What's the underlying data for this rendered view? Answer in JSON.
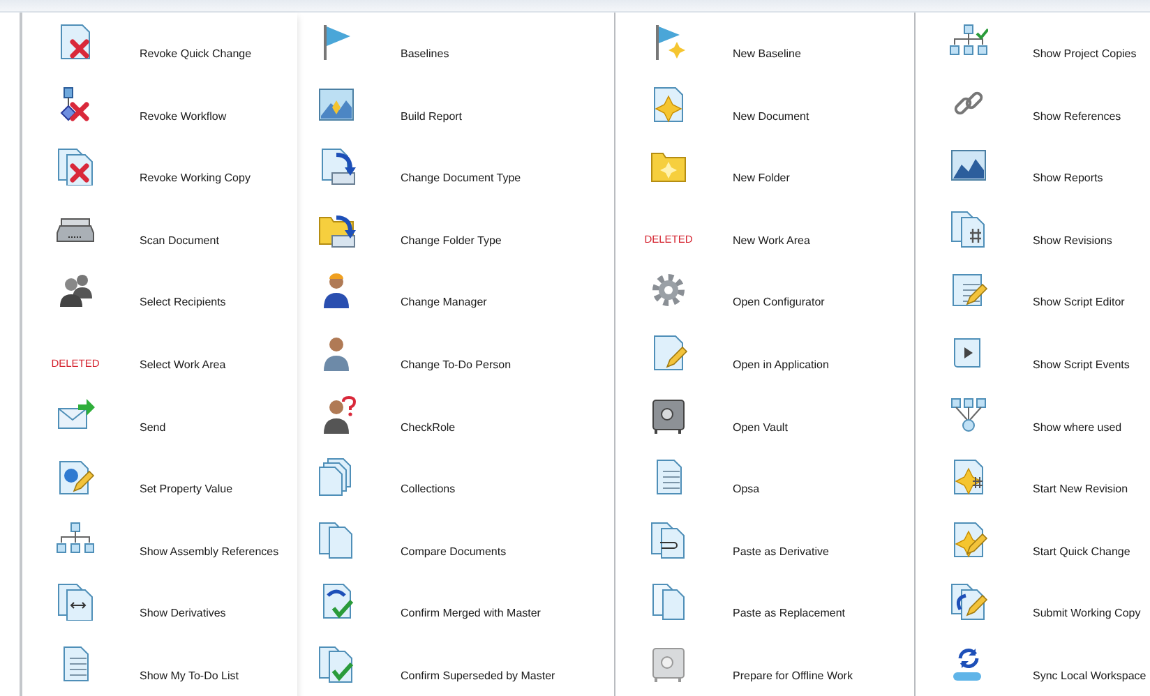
{
  "columns": [
    {
      "items": [
        {
          "label": "Revoke Quick Change"
        },
        {
          "label": "Revoke Workflow"
        },
        {
          "label": "Revoke Working Copy"
        },
        {
          "label": "Scan Document"
        },
        {
          "label": "Select Recipients"
        },
        {
          "label": "Select Work Area",
          "tag": "DELETED"
        },
        {
          "label": "Send"
        },
        {
          "label": "Set Property Value"
        },
        {
          "label": "Show Assembly References"
        },
        {
          "label": "Show Derivatives"
        },
        {
          "label": "Show My To-Do List"
        }
      ]
    },
    {
      "items": [
        {
          "label": "Baselines"
        },
        {
          "label": "Build Report"
        },
        {
          "label": "Change Document Type"
        },
        {
          "label": "Change Folder Type"
        },
        {
          "label": "Change Manager"
        },
        {
          "label": "Change To-Do Person"
        },
        {
          "label": "CheckRole"
        },
        {
          "label": "Collections"
        },
        {
          "label": "Compare Documents"
        },
        {
          "label": "Confirm Merged with Master"
        },
        {
          "label": "Confirm Superseded by Master"
        }
      ]
    },
    {
      "items": [
        {
          "label": "New Baseline"
        },
        {
          "label": "New Document"
        },
        {
          "label": "New Folder"
        },
        {
          "label": "New Work Area",
          "tag": "DELETED"
        },
        {
          "label": "Open Configurator"
        },
        {
          "label": "Open in Application"
        },
        {
          "label": "Open Vault"
        },
        {
          "label": "Opsa"
        },
        {
          "label": "Paste as Derivative"
        },
        {
          "label": "Paste as Replacement"
        },
        {
          "label": "Prepare for Offline Work"
        }
      ]
    },
    {
      "items": [
        {
          "label": "Show Project Copies"
        },
        {
          "label": "Show References"
        },
        {
          "label": "Show Reports"
        },
        {
          "label": "Show Revisions"
        },
        {
          "label": "Show Script Editor"
        },
        {
          "label": "Show Script Events"
        },
        {
          "label": "Show where used"
        },
        {
          "label": "Start New Revision"
        },
        {
          "label": "Start Quick Change"
        },
        {
          "label": "Submit Working Copy"
        },
        {
          "label": "Sync Local Workspace"
        }
      ]
    }
  ]
}
